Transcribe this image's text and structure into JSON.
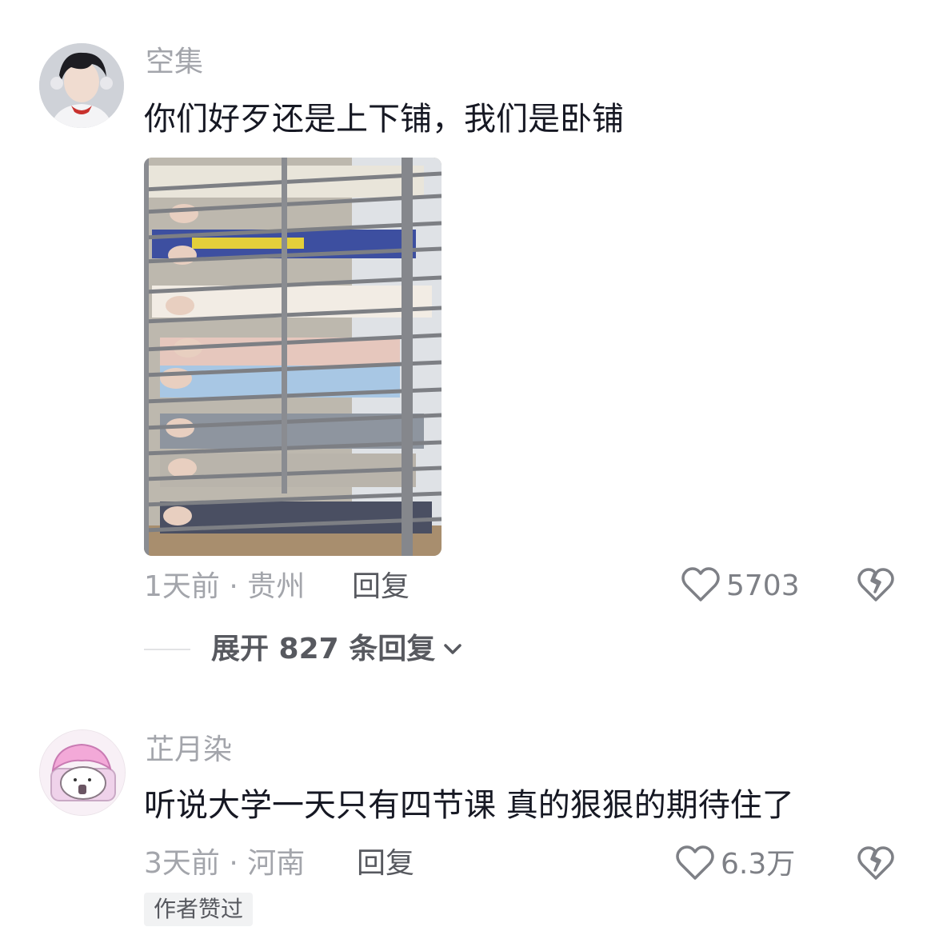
{
  "comments": [
    {
      "username": "空集",
      "text": "你们好歹还是上下铺，我们是卧铺",
      "time_location": "1天前 · 贵州",
      "reply_label": "回复",
      "likes": "5703",
      "expand_label": "展开 827 条回复"
    },
    {
      "username": "芷月染",
      "text": "听说大学一天只有四节课 真的狠狠的期待住了",
      "time_location": "3天前 · 河南",
      "reply_label": "回复",
      "likes": "6.3万",
      "badge": "作者赞过"
    }
  ],
  "icons": {
    "like": "heart-outline-icon",
    "dislike": "broken-heart-icon",
    "expand": "chevron-down-icon"
  },
  "colors": {
    "text_primary": "#161823",
    "text_secondary": "#a3a5ab",
    "action": "#57595f"
  }
}
